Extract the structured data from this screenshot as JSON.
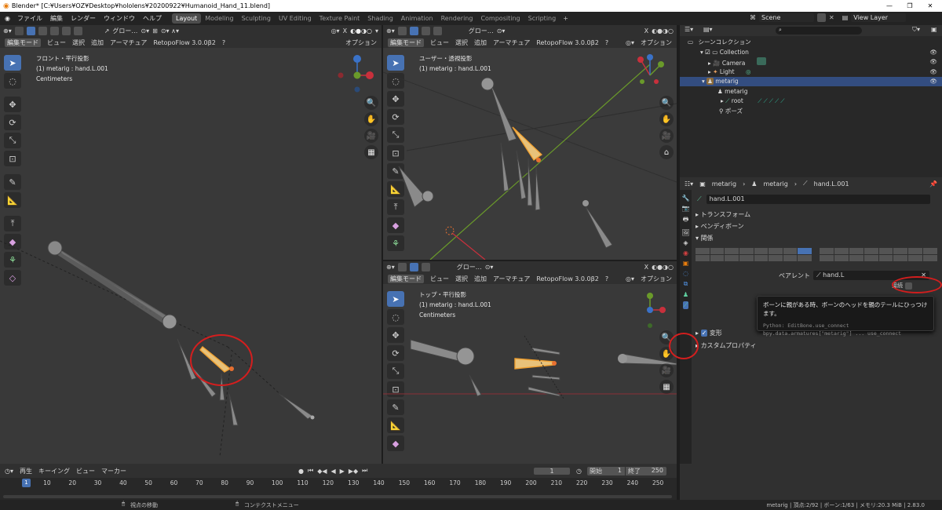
{
  "window": {
    "title": "Blender* [C:¥Users¥OZ¥Desktop¥hololens¥20200922¥Humanoid_Hand_11.blend]"
  },
  "menu": [
    "ファイル",
    "編集",
    "レンダー",
    "ウィンドウ",
    "ヘルプ"
  ],
  "workspaces": [
    "Layout",
    "Modeling",
    "Sculpting",
    "UV Editing",
    "Texture Paint",
    "Shading",
    "Animation",
    "Rendering",
    "Compositing",
    "Scripting"
  ],
  "scene": {
    "name": "Scene",
    "view_layer": "View Layer"
  },
  "viewport_header": {
    "mode": "編集モード",
    "view": "ビュー",
    "select": "選択",
    "add": "追加",
    "armature": "アーマチュア",
    "addon": "RetopoFlow 3.0.0β2",
    "transform": "グロー…",
    "options": "オプション"
  },
  "viewports": {
    "front": {
      "name": "フロント・平行投影",
      "object": "(1) metarig : hand.L.001",
      "units": "Centimeters"
    },
    "user": {
      "name": "ユーザー・透視投影",
      "object": "(1) metarig : hand.L.001"
    },
    "top": {
      "name": "トップ・平行投影",
      "object": "(1) metarig : hand.L.001",
      "units": "Centimeters"
    }
  },
  "outliner": {
    "search_placeholder": "",
    "scene_collection": "シーンコレクション",
    "items": [
      "Collection",
      "Camera",
      "Light",
      "metarig",
      "metarig",
      "root",
      "ポーズ"
    ]
  },
  "properties": {
    "breadcrumb": [
      "metarig",
      "metarig",
      "hand.L.001"
    ],
    "bone_name": "hand.L.001",
    "panels": [
      "トランスフォーム",
      "ベンディボーン",
      "関係",
      "変形",
      "カスタムプロパティ"
    ],
    "parent_label": "ペアレント",
    "parent_value": "hand.L",
    "connect_label": "接続",
    "tooltip": {
      "title": "ボーンに親がある時、ボーンのヘッドを親のテールにひっつけます。",
      "python": "Python: EditBone.use_connect",
      "path": "bpy.data.armatures[\"metarig\"] ... use_connect"
    }
  },
  "timeline": {
    "menus": [
      "再生",
      "キーイング",
      "ビュー",
      "マーカー"
    ],
    "current_frame": "1",
    "start_label": "開始",
    "start": "1",
    "end_label": "終了",
    "end": "250",
    "ticks": [
      "1",
      "10",
      "20",
      "30",
      "40",
      "50",
      "60",
      "70",
      "80",
      "90",
      "100",
      "110",
      "120",
      "130",
      "140",
      "150",
      "160",
      "170",
      "180",
      "190",
      "200",
      "210",
      "220",
      "230",
      "240",
      "250"
    ]
  },
  "status": {
    "left": "視点の移動",
    "mid": "コンテクストメニュー",
    "right": "metarig | 頂点:2/92 | ボーン:1/63 | メモリ:20.3 MiB | 2.83.0"
  },
  "colors": {
    "accent": "#4772b3",
    "annotation": "#d41e1e",
    "bone_selected": "#f0a030",
    "x_axis": "#c8303c",
    "y_axis": "#6a9a2a",
    "z_axis": "#3a72c8"
  }
}
